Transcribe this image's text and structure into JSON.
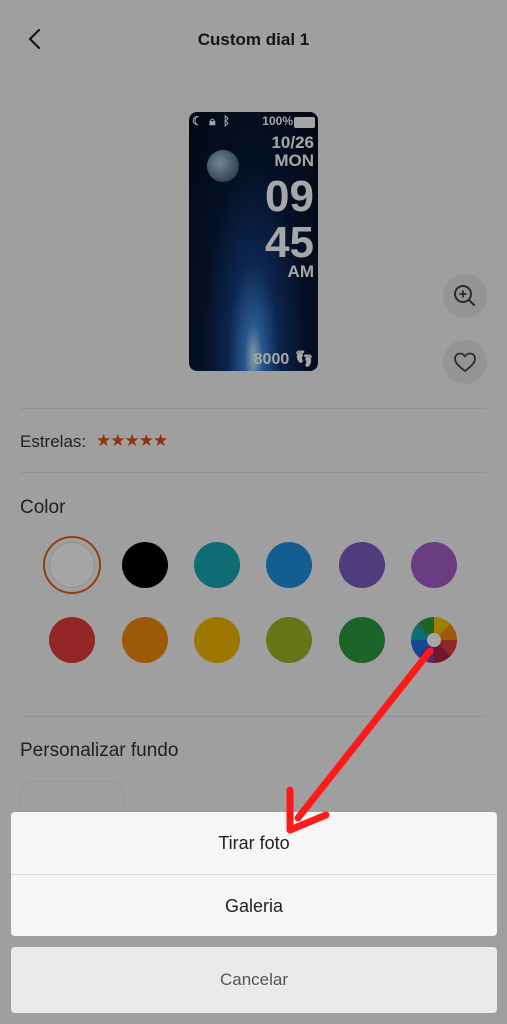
{
  "header": {
    "title": "Custom dial 1"
  },
  "watch_face": {
    "status_battery": "100%",
    "date": "10/26",
    "weekday": "MON",
    "hour": "09",
    "minute": "45",
    "ampm": "AM",
    "steps": "8000"
  },
  "rating": {
    "label": "Estrelas:",
    "stars": "★★★★★"
  },
  "color_section": {
    "title": "Color",
    "swatches": [
      "#ffffff",
      "#000000",
      "#18a5b3",
      "#1f8fe0",
      "#7a5cc4",
      "#a35ec6",
      "#e03b3b",
      "#f08a0a",
      "#f2b500",
      "#9cb525",
      "#2d9a3f",
      "multicolor"
    ],
    "selected": "#ffffff"
  },
  "background_section": {
    "title": "Personalizar fundo"
  },
  "action_sheet": {
    "take_photo": "Tirar foto",
    "gallery": "Galeria",
    "cancel": "Cancelar"
  },
  "annotation": {
    "arrow_color": "#ff1a1a"
  }
}
